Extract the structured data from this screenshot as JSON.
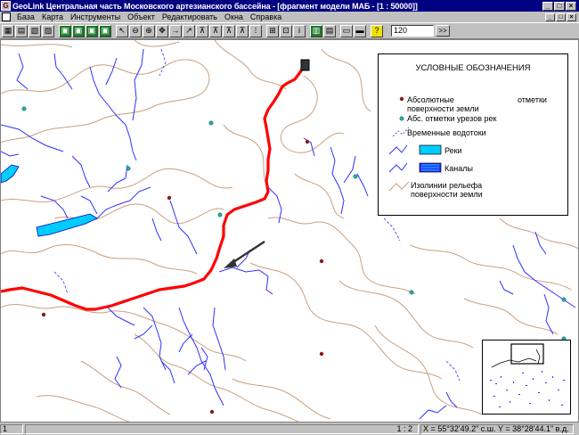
{
  "window": {
    "title": "GeoLink Центральная часть Московского артезианского бассейна - [фрагмент модели МАБ - [1 : 50000]]",
    "app_icon_glyph": "G",
    "minimize": "_",
    "maximize": "□",
    "close": "×"
  },
  "menu": {
    "items": [
      "База",
      "Карта",
      "Инструменты",
      "Объект",
      "Редактировать",
      "Окна",
      "Справка"
    ]
  },
  "toolbar": {
    "scale_value": "120",
    "scale_button": ">>"
  },
  "legend": {
    "title": "УСЛОВНЫЕ ОБОЗНАЧЕНИЯ",
    "items": {
      "abs_line1": "Абсолютные",
      "abs_line1b": "отметки",
      "abs_line2": "поверхности земли",
      "cuts": "Абс. отметки урезов рек",
      "temp": "Временные водотоки",
      "rivers": "Реки",
      "canals": "Каналы",
      "iso_line1": "Изолинии рельефа",
      "iso_line2": "поверхности земли"
    },
    "colors": {
      "elevation_point": "#8b1a1a",
      "cut_point": "#20b0b0",
      "water": "#00ccff",
      "stream": "#3030ff",
      "contour": "#c8a080",
      "route": "#ff0000"
    }
  },
  "statusbar": {
    "cell1": "1",
    "cell2": "1 : 2",
    "coords": "X = 55°32'49.2\" с.ш.  Y = 38°28'44.1\" в.д."
  }
}
